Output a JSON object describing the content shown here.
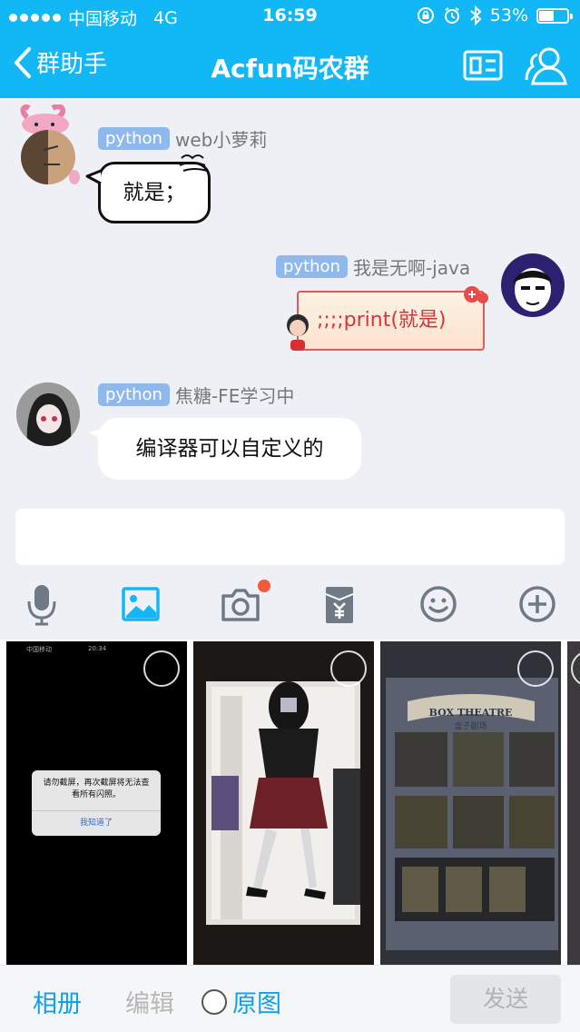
{
  "status_bar": {
    "carrier": "中国移动",
    "network": "4G",
    "time": "16:59",
    "battery": "53%",
    "battery_level": 0.53
  },
  "nav": {
    "back_label": "群助手",
    "title": "Acfun码农群"
  },
  "messages": [
    {
      "side": "left",
      "tag": "python",
      "sender": "web小萝莉",
      "text": "就是；"
    },
    {
      "side": "right",
      "tag": "python",
      "sender": "我是无啊-java",
      "text": ";;;;print(就是)"
    },
    {
      "side": "left",
      "tag": "python",
      "sender": "焦糖-FE学习中",
      "text": "编译器可以自定义的"
    }
  ],
  "toolbar": {
    "icons": [
      "microphone-icon",
      "image-icon",
      "camera-icon",
      "red-packet-icon",
      "emoji-icon",
      "plus-icon"
    ],
    "active_color": "#12b7f5",
    "default_color": "#707a84",
    "badge_color": "#f25a3a"
  },
  "photos": {
    "photo1_dialog_text": "请勿截屏，再次截屏将无法查看所有闪照。",
    "photo1_dialog_button": "我知道了",
    "photo1_status_carrier": "中国移动",
    "photo1_status_time": "20:34",
    "photo3_sign": "BOX THEATRE",
    "photo3_sub": "盒子剧场"
  },
  "bottom_bar": {
    "album": "相册",
    "edit": "编辑",
    "original": "原图",
    "send": "发送"
  },
  "colors": {
    "brand": "#12b7f5",
    "background": "#eef0f5",
    "tag": "#8fb8ec"
  }
}
